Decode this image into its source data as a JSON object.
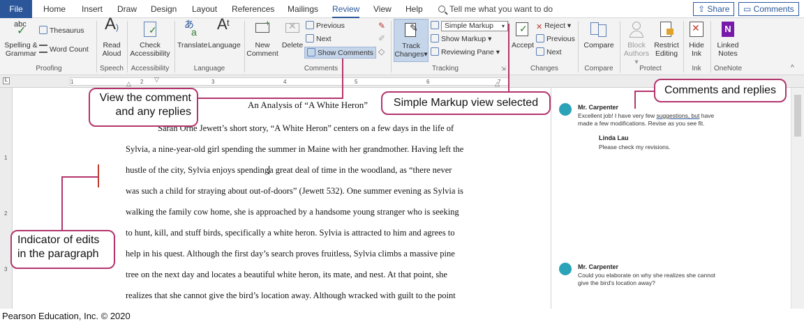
{
  "tabs": {
    "file": "File",
    "items": [
      "Home",
      "Insert",
      "Draw",
      "Design",
      "Layout",
      "References",
      "Mailings",
      "Review",
      "View",
      "Help"
    ],
    "active": "Review",
    "tell_me": "Tell me what you want to do",
    "share": "Share",
    "comments": "Comments"
  },
  "ribbon": {
    "proofing": {
      "label": "Proofing",
      "spelling_line1": "Spelling &",
      "spelling_line2": "Grammar",
      "abc": "abc",
      "thesaurus": "Thesaurus",
      "word_count": "Word Count"
    },
    "speech": {
      "label": "Speech",
      "read_line1": "Read",
      "read_line2": "Aloud"
    },
    "accessibility": {
      "label": "Accessibility",
      "check_line1": "Check",
      "check_line2": "Accessibility"
    },
    "language": {
      "label": "Language",
      "translate": "Translate",
      "language": "Language"
    },
    "comments": {
      "label": "Comments",
      "new_line1": "New",
      "new_line2": "Comment",
      "delete": "Delete",
      "previous": "Previous",
      "next": "Next",
      "show_comments": "Show Comments"
    },
    "tracking": {
      "label": "Tracking",
      "track_line1": "Track",
      "track_line2": "Changes",
      "markup_select": "Simple Markup",
      "show_markup": "Show Markup",
      "reviewing_pane": "Reviewing Pane"
    },
    "changes": {
      "label": "Changes",
      "accept": "Accept",
      "reject": "Reject",
      "previous": "Previous",
      "next": "Next"
    },
    "compare": {
      "label": "Compare",
      "compare": "Compare"
    },
    "protect": {
      "label": "Protect",
      "block_line1": "Block",
      "block_line2": "Authors",
      "restrict_line1": "Restrict",
      "restrict_line2": "Editing"
    },
    "ink": {
      "label": "Ink",
      "hide_line1": "Hide",
      "hide_line2": "Ink"
    },
    "onenote": {
      "label": "OneNote",
      "linked_line1": "Linked",
      "linked_line2": "Notes"
    }
  },
  "ruler": {
    "numbers": [
      "1",
      "2",
      "3",
      "4",
      "5",
      "6",
      "7"
    ],
    "vnumbers": [
      "1",
      "2",
      "3"
    ]
  },
  "document": {
    "title": "An Analysis of “A White Heron”",
    "lines": [
      "Sarah Orne Jewett’s short story, “A White Heron” centers on a few days in the life of",
      "Sylvia, a nine-year-old girl spending the summer in Maine with her grandmother. Having left the",
      "hustle of the city, Sylvia enjoys spending",
      "was such a child for straying about out-of-doors” (Jewett 532).  One summer evening as Sylvia is",
      "walking the family cow home, she is approached by a handsome young stranger who is seeking",
      "to hunt, kill, and stuff birds, specifically a white heron. Sylvia is attracted to him and agrees to",
      "help in his quest. Although the first day’s search proves fruitless, Sylvia climbs a massive pine",
      "tree on the next day and locates a beautiful white heron, its mate, and nest. At that point, she",
      "realizes that she cannot give the bird’s location away. Although wracked with guilt to the point"
    ],
    "line3_tail": "a great deal of time in the woodland, as “there never"
  },
  "comments": [
    {
      "author": "Mr. Carpenter",
      "text1_a": "Excellent job! I have very few ",
      "text1_u": "suggestions, but",
      "text1_b": " have",
      "text2": "made a few modifications. Revise as you see fit."
    },
    {
      "author": "Linda Lau",
      "text1": "Please check my revisions."
    },
    {
      "author": "Mr. Carpenter",
      "text1": "Could you elaborate on why she realizes she cannot",
      "text2": "give the bird’s location away?"
    }
  ],
  "callouts": {
    "view_comment_line1": "View the comment",
    "view_comment_line2": "and any replies",
    "simple_markup": "Simple Markup view selected",
    "comments_replies": "Comments and replies",
    "indicator_line1": "Indicator of edits",
    "indicator_line2": "in the paragraph"
  },
  "footer": "Pearson Education, Inc. © 2020",
  "colors": {
    "accent": "#2b579a",
    "callout": "#b3346c",
    "avatar": "#2aa2b8",
    "change_bar": "#c0392b"
  }
}
